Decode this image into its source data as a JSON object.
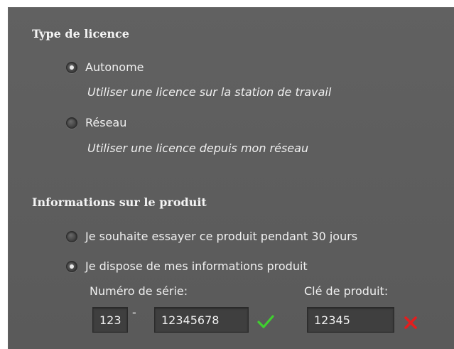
{
  "license_type": {
    "title": "Type de licence",
    "options": [
      {
        "label": "Autonome",
        "description": "Utiliser une licence sur la station de travail",
        "checked": true
      },
      {
        "label": "Réseau",
        "description": "Utiliser une licence depuis mon réseau",
        "checked": false
      }
    ]
  },
  "product_info": {
    "title": "Informations sur le produit",
    "options": [
      {
        "label": "Je souhaite essayer ce produit pendant 30 jours",
        "checked": false
      },
      {
        "label": "Je dispose de mes informations produit",
        "checked": true
      }
    ],
    "serial_label": "Numéro de série:",
    "key_label": "Clé de produit:",
    "serial_prefix": "123",
    "serial_separator": "-",
    "serial_number": "12345678",
    "product_key": "12345",
    "serial_status": "valid",
    "key_status": "invalid"
  },
  "colors": {
    "panel": "#5f5f5f",
    "valid": "#3fcf2f",
    "invalid": "#e31e1e"
  },
  "icons": {
    "serial_status": "check-icon",
    "key_status": "cross-icon"
  }
}
